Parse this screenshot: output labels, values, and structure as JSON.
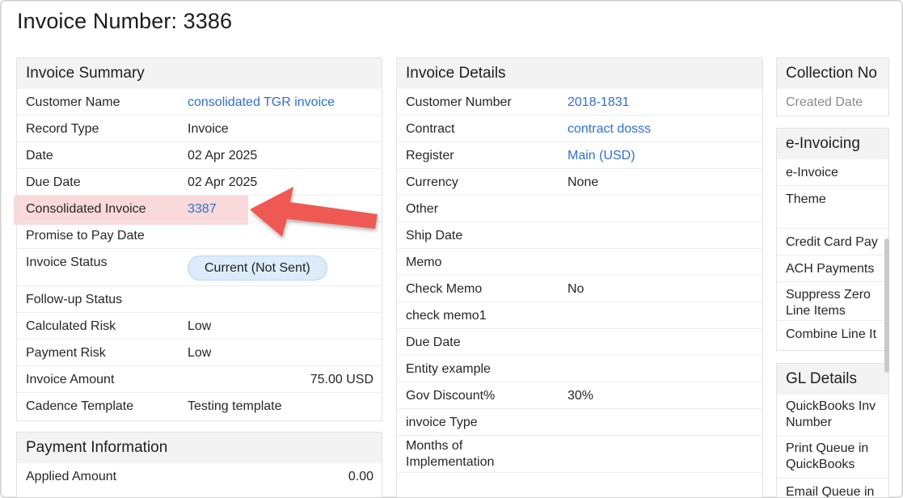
{
  "page": {
    "title": "Invoice Number: 3386"
  },
  "invoice_summary": {
    "header": "Invoice Summary",
    "rows": [
      {
        "label": "Customer Name",
        "value": "consolidated TGR invoice"
      },
      {
        "label": "Record Type",
        "value": "Invoice"
      },
      {
        "label": "Date",
        "value": "02 Apr 2025"
      },
      {
        "label": "Due Date",
        "value": "02 Apr 2025"
      },
      {
        "label": "Consolidated Invoice",
        "value": "3387"
      },
      {
        "label": "Promise to Pay Date",
        "value": ""
      },
      {
        "label": "Invoice Status",
        "value": "Current (Not Sent)"
      },
      {
        "label": "Follow-up Status",
        "value": ""
      },
      {
        "label": "Calculated Risk",
        "value": "Low"
      },
      {
        "label": "Payment Risk",
        "value": "Low"
      },
      {
        "label": "Invoice Amount",
        "value": "75.00 USD"
      },
      {
        "label": "Cadence Template",
        "value": "Testing template"
      }
    ]
  },
  "payment_information": {
    "header": "Payment Information",
    "rows": [
      {
        "label": "Applied Amount",
        "value": "0.00"
      }
    ]
  },
  "invoice_details": {
    "header": "Invoice Details",
    "rows": [
      {
        "label": "Customer Number",
        "value": "2018-1831"
      },
      {
        "label": "Contract",
        "value": "contract dosss"
      },
      {
        "label": "Register",
        "value": "Main (USD)"
      },
      {
        "label": "Currency",
        "value": "None"
      },
      {
        "label": "Other",
        "value": ""
      },
      {
        "label": "Ship Date",
        "value": ""
      },
      {
        "label": "Memo",
        "value": ""
      },
      {
        "label": "Check Memo",
        "value": "No"
      },
      {
        "label": "check memo1",
        "value": ""
      },
      {
        "label": "Due Date",
        "value": ""
      },
      {
        "label": "Entity example",
        "value": ""
      },
      {
        "label": "Gov Discount%",
        "value": "30%"
      },
      {
        "label": "invoice Type",
        "value": ""
      },
      {
        "label": "Months of Implementation",
        "value": ""
      }
    ]
  },
  "collection_notes": {
    "header": "Collection No",
    "column_label": "Created Date"
  },
  "e_invoicing": {
    "header": "e-Invoicing",
    "rows": [
      {
        "label": "e-Invoice"
      },
      {
        "label": "Theme"
      },
      {
        "label": "Credit Card Pay"
      },
      {
        "label": "ACH Payments"
      },
      {
        "label": "Suppress Zero Line Items"
      },
      {
        "label": "Combine Line It"
      }
    ]
  },
  "gl_details": {
    "header": "GL Details",
    "rows": [
      {
        "label": "QuickBooks Inv Number"
      },
      {
        "label": "Print Queue in QuickBooks"
      },
      {
        "label": "Email Queue in"
      }
    ]
  },
  "colors": {
    "link": "#2e6fd1",
    "highlight": "#f8d2d2",
    "arrow": "#ee5a52",
    "badge_bg": "#dcecfa"
  }
}
